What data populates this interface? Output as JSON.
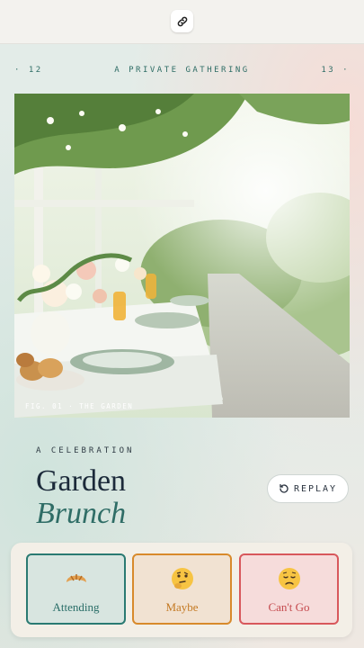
{
  "topbar": {
    "link_icon": "link-icon"
  },
  "meta": {
    "left_number": "· 12",
    "center": "A PRIVATE GATHERING",
    "right_number": "13 ·"
  },
  "photo": {
    "caption": "FIG. 01 · THE GARDEN"
  },
  "event": {
    "eyebrow": "A CELEBRATION",
    "title_line1": "Garden",
    "title_line2": "Brunch"
  },
  "replay": {
    "label": "REPLAY",
    "icon": "replay-icon"
  },
  "rsvp": {
    "options": [
      {
        "label": "Attending",
        "icon": "croissant-icon",
        "color": "#2a7a72"
      },
      {
        "label": "Maybe",
        "icon": "thinking-face-icon",
        "color": "#d88a2c"
      },
      {
        "label": "Can't Go",
        "icon": "sad-face-icon",
        "color": "#d8585c"
      }
    ]
  },
  "colors": {
    "accent": "#2f6d66",
    "title": "#1c2a3a"
  }
}
